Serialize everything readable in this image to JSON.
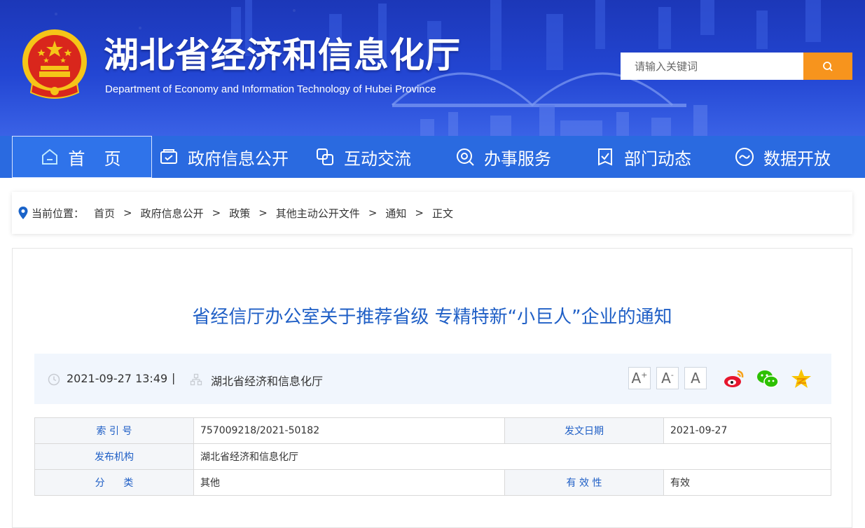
{
  "header": {
    "title": "湖北省经济和信息化厅",
    "subtitle": "Department of Economy and Information Technology of Hubei Province",
    "search_placeholder": "请输入关键词"
  },
  "nav": {
    "items": [
      {
        "label": "首  页",
        "icon": "home-icon"
      },
      {
        "label": "政府信息公开",
        "icon": "info-folder-icon"
      },
      {
        "label": "互动交流",
        "icon": "chat-icon"
      },
      {
        "label": "办事服务",
        "icon": "service-search-icon"
      },
      {
        "label": "部门动态",
        "icon": "news-icon"
      },
      {
        "label": "数据开放",
        "icon": "data-wave-icon"
      }
    ]
  },
  "breadcrumb": {
    "prefix": "当前位置：",
    "items": [
      "首页",
      "政府信息公开",
      "政策",
      "其他主动公开文件",
      "通知",
      "正文"
    ],
    "separator": ">"
  },
  "article": {
    "title": "省经信厅办公室关于推荐省级 专精特新“小巨人”企业的通知",
    "datetime": "2021-09-27 13:49",
    "divider": "|",
    "source": "湖北省经济和信息化厅",
    "font_controls": [
      "A",
      "A",
      "A"
    ]
  },
  "info_table": {
    "index_label": "索 引 号",
    "index_value": "757009218/2021-50182",
    "date_label": "发文日期",
    "date_value": "2021-09-27",
    "issuer_label": "发布机构",
    "issuer_value": "湖北省经济和信息化厅",
    "category_label": "分      类",
    "category_value": "其他",
    "validity_label": "有 效 性",
    "validity_value": "有效"
  },
  "colors": {
    "header_blue": "#2346d3",
    "nav_blue": "#2a6ae0",
    "search_button": "#f7941d",
    "title_blue": "#1f5fc6"
  }
}
